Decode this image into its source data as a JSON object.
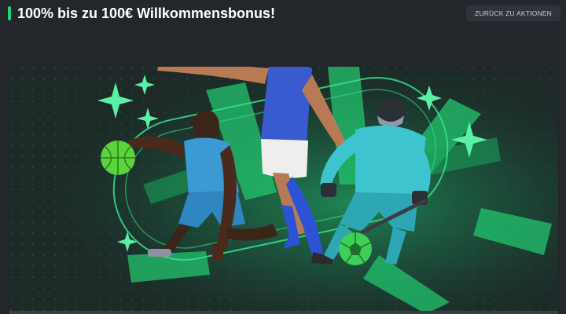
{
  "header": {
    "title": "100% bis zu 100€ Willkommensbonus!",
    "back_label": "ZURÜCK ZU AKTIONEN"
  },
  "banner": {
    "image_name": "sports-players-hero"
  },
  "colors": {
    "background": "#23262b",
    "accent": "#1fd67a",
    "button_bg": "#2f333a",
    "banner_bg": "#1c2b28"
  }
}
